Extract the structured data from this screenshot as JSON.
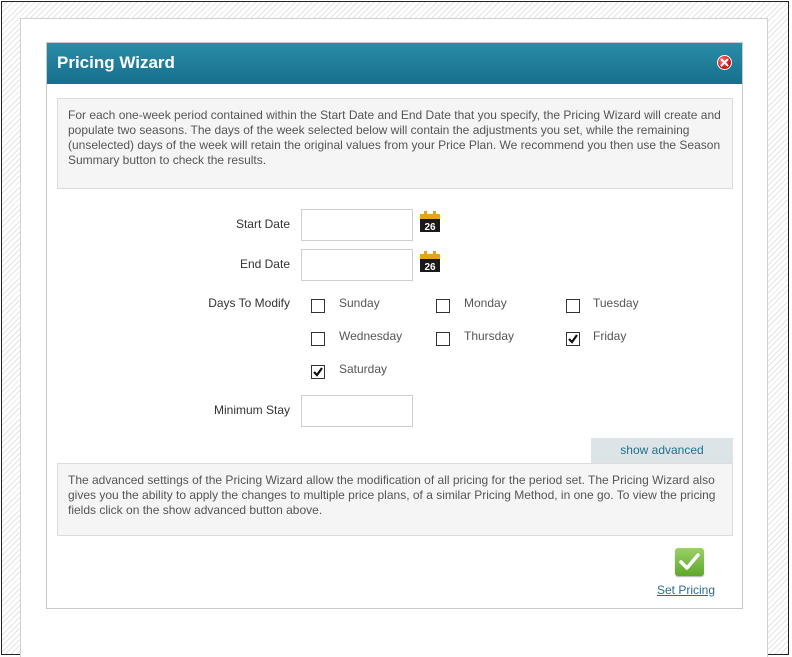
{
  "dialog": {
    "title": "Pricing Wizard",
    "close_icon": "close-icon"
  },
  "intro_text": "For each one-week period contained within the Start Date and End Date that you specify, the Pricing Wizard will create and populate two seasons. The days of the week selected below will contain the adjustments you set, while the remaining (unselected) days of the week will retain the original values from your Price Plan. We recommend you then use the Season Summary button to check the results.",
  "form": {
    "start_date": {
      "label": "Start Date",
      "value": "",
      "icon": "calendar-icon",
      "calendar_day": "26"
    },
    "end_date": {
      "label": "End Date",
      "value": "",
      "icon": "calendar-icon",
      "calendar_day": "26"
    },
    "days_label": "Days To Modify",
    "days": [
      {
        "name": "Sunday",
        "checked": false
      },
      {
        "name": "Monday",
        "checked": false
      },
      {
        "name": "Tuesday",
        "checked": false
      },
      {
        "name": "Wednesday",
        "checked": false
      },
      {
        "name": "Thursday",
        "checked": false
      },
      {
        "name": "Friday",
        "checked": true
      },
      {
        "name": "Saturday",
        "checked": true
      }
    ],
    "minimum_stay": {
      "label": "Minimum Stay",
      "value": ""
    }
  },
  "advanced": {
    "tab_label": "show advanced",
    "text": "The advanced settings of the Pricing Wizard allow the modification of all pricing for the period set. The Pricing Wizard also gives you the ability to apply the changes to multiple price plans, of a similar Pricing Method, in one go. To view the pricing fields click on the show advanced button above."
  },
  "actions": {
    "set_pricing_label": "Set Pricing",
    "set_pricing_icon": "checkmark-icon"
  },
  "colors": {
    "header": "#1f7f9c",
    "link": "#2b6c8e",
    "close": "#d01616",
    "confirm": "#6db33f"
  }
}
